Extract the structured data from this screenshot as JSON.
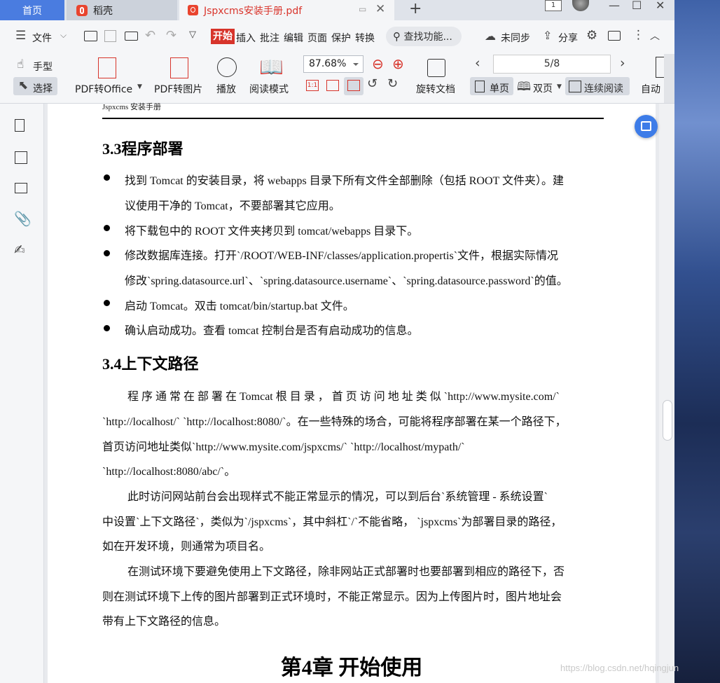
{
  "tabs": {
    "home": "首页",
    "daoke": "稻壳",
    "doc": "Jspxcms安装手册.pdf",
    "new_tab": "+"
  },
  "window": {
    "badge": "1",
    "minimize": "—",
    "maximize": "☐",
    "close": "✕"
  },
  "menu": {
    "file": "文件",
    "start": "开始",
    "items": [
      "插入",
      "批注",
      "编辑",
      "页面",
      "保护",
      "转换"
    ],
    "search": "查找功能...",
    "sync": "未同步",
    "share": "分享"
  },
  "ribbon": {
    "hand": "手型",
    "select": "选择",
    "pdf_to_office": "PDF转Office",
    "pdf_to_image": "PDF转图片",
    "play": "播放",
    "read_mode": "阅读模式",
    "zoom": "87.68%",
    "rotate": "旋转文档",
    "page_indicator": "5/8",
    "single": "单页",
    "double": "双页",
    "continuous": "连续阅读",
    "auto": "自动"
  },
  "document": {
    "running_head": "Jspxcms 安装手册",
    "s33_title": "3.3程序部署",
    "s33_lines": [
      "找到 Tomcat 的安装目录，将 webapps 目录下所有文件全部删除（包括 ROOT 文件夹）。建",
      "议使用干净的  Tomcat，不要部署其它应用。",
      "将下载包中的  ROOT  文件夹拷贝到  tomcat/webapps  目录下。",
      "修改数据库连接。打开`/ROOT/WEB-INF/classes/application.propertis`文件，根据实际情况",
      "修改`spring.datasource.url`、`spring.datasource.username`、`spring.datasource.password`的值。",
      "启动 Tomcat。双击  tomcat/bin/startup.bat  文件。",
      "确认启动成功。查看  tomcat  控制台是否有启动成功的信息。"
    ],
    "s34_title": "3.4上下文路径",
    "s34_lines": [
      "程 序 通 常 在 部 署 在   Tomcat  根 目 录 ， 首 页 访 问 地 址 类 似 `http://www.mysite.com/`",
      "`http://localhost/` `http://localhost:8080/`。在一些特殊的场合，可能将程序部署在某一个路径下，",
      "首页访问地址类似`http://www.mysite.com/jspxcms/`    `http://localhost/mypath/`",
      "`http://localhost:8080/abc/`。",
      "此时访问网站前台会出现样式不能正常显示的情况，可以到后台`系统管理  -  系统设置`",
      "中设置`上下文路径`，类似为`/jspxcms`，其中斜杠`/`不能省略，  `jspxcms`为部署目录的路径，",
      "如在开发环境，则通常为项目名。",
      "在测试环境下要避免使用上下文路径，除非网站正式部署时也要部署到相应的路径下，否",
      "则在测试环境下上传的图片部署到正式环境时，不能正常显示。因为上传图片时，图片地址会",
      "带有上下文路径的信息。"
    ],
    "chapter4": "第4章  开始使用"
  },
  "watermark": "https://blog.csdn.net/hqingjun",
  "icons": [
    "menu-icon",
    "folder-icon",
    "save-icon",
    "print-icon",
    "undo-icon",
    "redo-icon",
    "hand-icon",
    "cursor-icon",
    "pdf-office-icon",
    "pdf-image-icon",
    "play-icon",
    "book-icon",
    "zoom-out-icon",
    "zoom-in-icon",
    "rotate-icon",
    "bookmark-icon",
    "image-icon",
    "comment-icon",
    "attachment-icon",
    "sign-icon",
    "cloud-icon",
    "share-icon",
    "gear-icon",
    "chat-icon",
    "more-icon",
    "collapse-icon"
  ],
  "colors": {
    "accent": "#d7342b",
    "home_tab": "#4a7ce0",
    "float_button": "#3d7ce8"
  }
}
